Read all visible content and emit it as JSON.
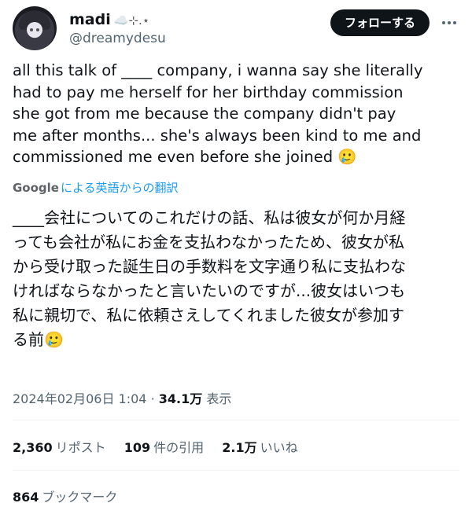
{
  "author": {
    "display_name": "madi",
    "display_name_decoration": "☁️⊹.⋆",
    "handle": "@dreamydesu"
  },
  "follow_button": "フォローする",
  "tweet_text": "all this talk of ____ company, i wanna say she literally\nhad to pay me herself for her birthday commission\nshe got from me because the company didn't pay\nme after months... she's always been kind to me and\ncommissioned me even before she joined 🥲",
  "translation": {
    "google_label": "Google",
    "label": "による英語からの翻訳"
  },
  "translated_text": "____会社についてのこれだけの話、私は彼女が何か月経\nっても会社が私にお金を支払わなかったため、彼女が私\nから受け取った誕生日の手数料を文字通り私に支払わな\nければならなかったと言いたいのですが...彼女はいつも\n私に親切で、私に依頼さえしてくれました彼女が参加す\nる前🥲",
  "meta": {
    "timestamp": "2024年02月06日 1:04",
    "separator": "·",
    "views_count": "34.1万",
    "views_label": "表示"
  },
  "stats": {
    "reposts_count": "2,360",
    "reposts_label": "リポスト",
    "quotes_count": "109",
    "quotes_label": "件の引用",
    "likes_count": "2.1万",
    "likes_label": "いいね"
  },
  "bookmarks": {
    "count": "864",
    "label": "ブックマーク"
  }
}
